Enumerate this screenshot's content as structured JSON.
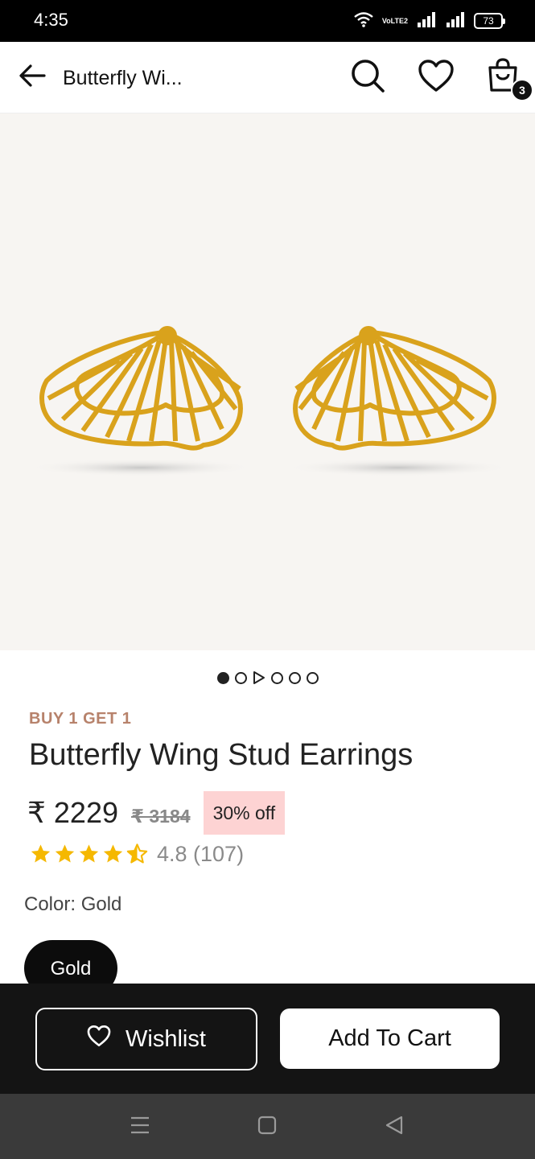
{
  "status_bar": {
    "time": "4:35",
    "network_label": "VoLTE2",
    "battery": "73",
    "icons": [
      "wifi-icon",
      "volte-icon",
      "signal-icon",
      "signal-icon",
      "battery-icon"
    ]
  },
  "header": {
    "title": "Butterfly Wi...",
    "cart_count": "3",
    "icons": [
      "back-arrow-icon",
      "search-icon",
      "heart-icon",
      "shopping-bag-icon"
    ]
  },
  "gallery": {
    "image_alt": "Gold butterfly wing stud earrings",
    "dot_count": 6,
    "active_index": 0,
    "video_index": 1
  },
  "product": {
    "offer": "BUY 1 GET 1",
    "title": "Butterfly Wing Stud Earrings",
    "price": "₹ 2229",
    "old_price": "₹ 3184",
    "discount": "30% off",
    "rating": 4.8,
    "rating_text": "4.8 (107)",
    "stars_full": 4,
    "stars_half": 1
  },
  "variants": {
    "color_label": "Color: Gold",
    "selected": "Gold"
  },
  "actions": {
    "wishlist_label": "Wishlist",
    "add_to_cart_label": "Add To Cart"
  },
  "colors": {
    "accent": "#b7826b",
    "gold": "#e6b422",
    "star": "#f5b800",
    "discount_bg": "#fdd3d3",
    "action_bar_bg": "#141414",
    "nav_bar_bg": "#3a3a3a"
  },
  "navigation": {
    "icons": [
      "menu-icon",
      "home-square-icon",
      "back-triangle-icon"
    ]
  }
}
